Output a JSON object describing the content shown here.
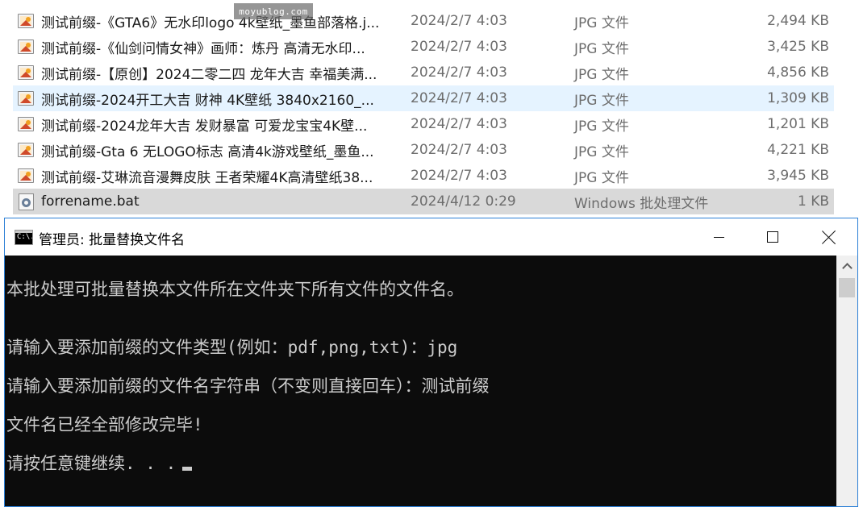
{
  "watermark": {
    "text": "moyublog.com"
  },
  "explorer": {
    "files": [
      {
        "name": "测试前缀-《GTA6》无水印logo 4k壁纸_墨鱼部落格.j...",
        "date": "2024/2/7 4:03",
        "type": "JPG 文件",
        "size": "2,494 KB",
        "icon": "jpg-image-icon"
      },
      {
        "name": "测试前缀-《仙剑问情女神》画师：炼丹 高清无水印...",
        "date": "2024/2/7 4:03",
        "type": "JPG 文件",
        "size": "3,425 KB",
        "icon": "jpg-image-icon"
      },
      {
        "name": "测试前缀-【原创】2024二零二四 龙年大吉 幸福美满...",
        "date": "2024/2/7 4:03",
        "type": "JPG 文件",
        "size": "4,856 KB",
        "icon": "jpg-image-icon"
      },
      {
        "name": "测试前缀-2024开工大吉 财神 4K壁纸 3840x2160_...",
        "date": "2024/2/7 4:03",
        "type": "JPG 文件",
        "size": "1,309 KB",
        "icon": "jpg-image-icon",
        "state": "hover"
      },
      {
        "name": "测试前缀-2024龙年大吉 发财暴富 可爱龙宝宝4K壁...",
        "date": "2024/2/7 4:03",
        "type": "JPG 文件",
        "size": "1,201 KB",
        "icon": "jpg-image-icon"
      },
      {
        "name": "测试前缀-Gta 6 无LOGO标志 高清4k游戏壁纸_墨鱼...",
        "date": "2024/2/7 4:03",
        "type": "JPG 文件",
        "size": "4,221 KB",
        "icon": "jpg-image-icon"
      },
      {
        "name": "测试前缀-艾琳流音漫舞皮肤 王者荣耀4K高清壁纸38...",
        "date": "2024/2/7 4:03",
        "type": "JPG 文件",
        "size": "3,945 KB",
        "icon": "jpg-image-icon"
      },
      {
        "name": "forrename.bat",
        "date": "2024/4/12 0:29",
        "type": "Windows 批处理文件",
        "size": "1 KB",
        "icon": "batch-file-icon",
        "state": "selected"
      }
    ]
  },
  "cmd": {
    "title": "管理员: 批量替换文件名",
    "icon_text": "C:\\.",
    "lines": [
      "本批处理可批量替换本文件所在文件夹下所有文件的文件名。",
      "请输入要添加前缀的文件类型(例如：pdf,png,txt)：jpg",
      "请输入要添加前缀的文件名字符串（不变则直接回车）：测试前缀",
      "文件名已经全部修改完毕!",
      "请按任意键继续. . ."
    ]
  },
  "colors": {
    "hover_row": "#e5f3ff",
    "selected_row": "#d9d9d9",
    "console_bg": "#0c0c0c",
    "console_text": "#cccccc",
    "window_border": "#2b7fd6"
  }
}
